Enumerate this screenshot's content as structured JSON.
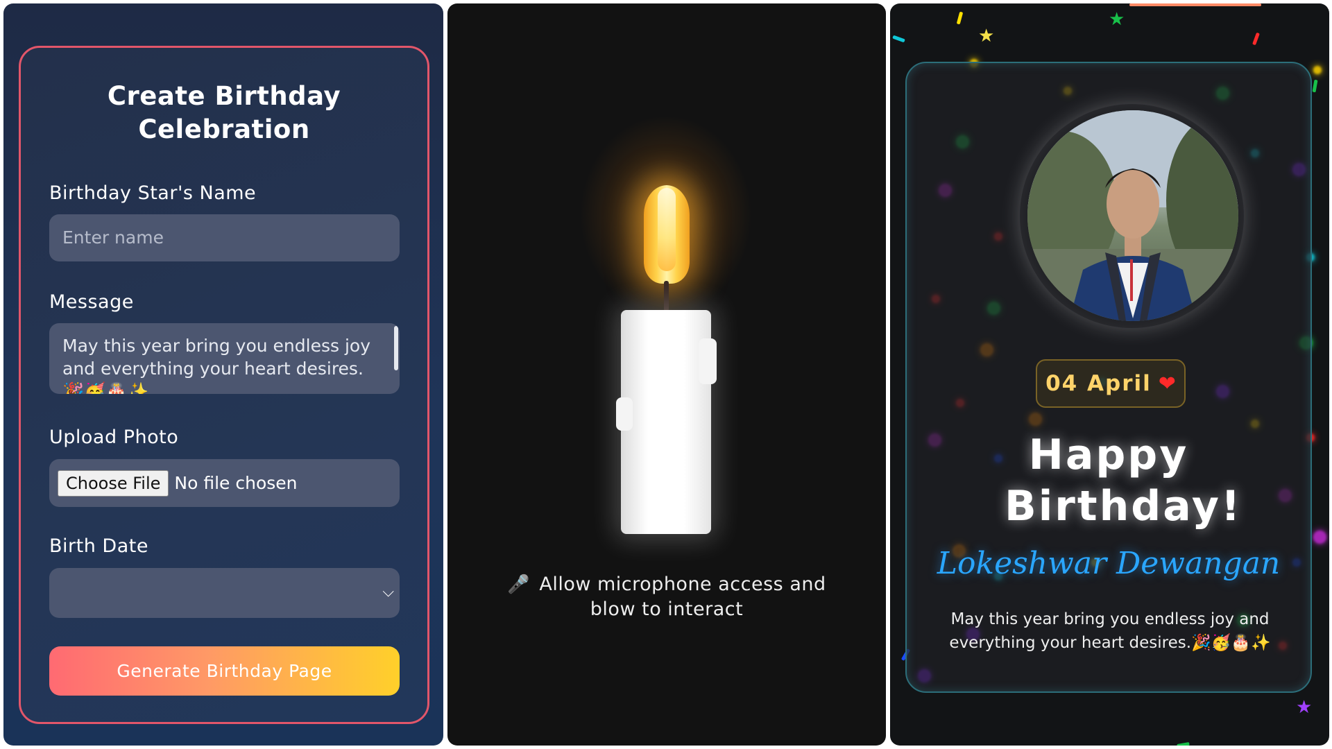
{
  "form": {
    "title": "Create Birthday Celebration",
    "name_label": "Birthday Star's Name",
    "name_placeholder": "Enter name",
    "message_label": "Message",
    "message_value": "May this year bring you endless joy and everything your heart desires.🎉🥳🎂✨",
    "photo_label": "Upload Photo",
    "file_button": "Choose File",
    "file_status": "No file chosen",
    "date_label": "Birth Date",
    "date_value": "",
    "generate_button": "Generate Birthday Page",
    "colors": {
      "border": "#e2566a",
      "button_start": "#ff6a72",
      "button_end": "#ffd02a"
    }
  },
  "candle": {
    "icon": "microphone-icon",
    "icon_glyph": "🎤",
    "prompt": "Allow microphone access and blow to interact"
  },
  "celebration": {
    "date": "04 April",
    "date_icon": "heart-icon",
    "heading": "Happy Birthday!",
    "name": "Lokeshwar Dewangan",
    "message": "May this year bring you endless joy and everything your heart desires.🎉🥳🎂✨",
    "colors": {
      "name": "#2aa6ff",
      "date": "#ffd36a",
      "card_border": "#2c6e7a"
    }
  }
}
